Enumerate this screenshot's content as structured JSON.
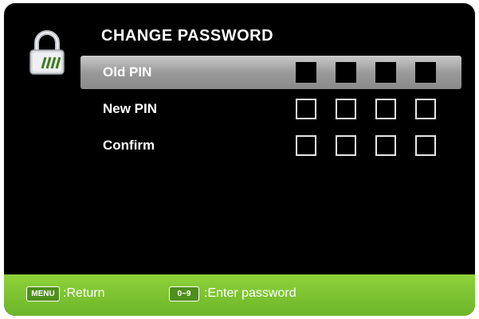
{
  "title": "CHANGE PASSWORD",
  "rows": [
    {
      "label": "Old PIN",
      "selected": true
    },
    {
      "label": "New PIN",
      "selected": false
    },
    {
      "label": "Confirm",
      "selected": false
    }
  ],
  "icon": "padlock-icon",
  "footer": {
    "menu_key": "MENU",
    "menu_text": ":Return",
    "digits_key": "0~9",
    "digits_text": ":Enter password"
  },
  "colors": {
    "background": "#000000",
    "footer_green": "#7cc431",
    "selection_gray": "#a6a6a6",
    "text": "#ffffff"
  }
}
